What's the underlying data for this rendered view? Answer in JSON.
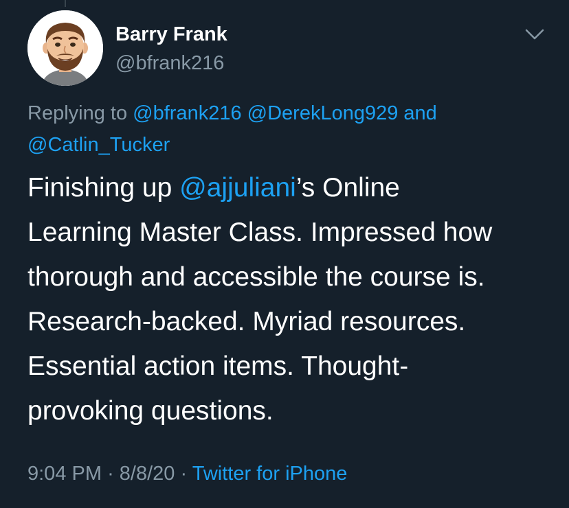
{
  "tweet": {
    "author": {
      "name": "Barry Frank",
      "handle": "@bfrank216"
    },
    "menu_icon": "chevron-down-icon",
    "reply_context": {
      "prefix": "Replying to",
      "mention_1": "@bfrank216",
      "mention_2": "@DerekLong929",
      "conjunction": "and",
      "mention_3": "@Catlin_Tucker"
    },
    "body": {
      "line1_before": "Finishing up ",
      "mention": "@ajjuliani",
      "line1_after": "’s Online",
      "line2": "Learning Master Class. Impressed how",
      "line3": "thorough and accessible the course is.",
      "line4": "Research-backed. Myriad resources.",
      "line5": "Essential action items. Thought-",
      "line6": "provoking questions."
    },
    "meta": {
      "time": "9:04 PM",
      "separator": "·",
      "date": "8/8/20",
      "source": "Twitter for iPhone"
    },
    "colors": {
      "background": "#15202b",
      "text": "#ffffff",
      "secondary": "#8899a6",
      "link": "#1da1f2"
    }
  }
}
